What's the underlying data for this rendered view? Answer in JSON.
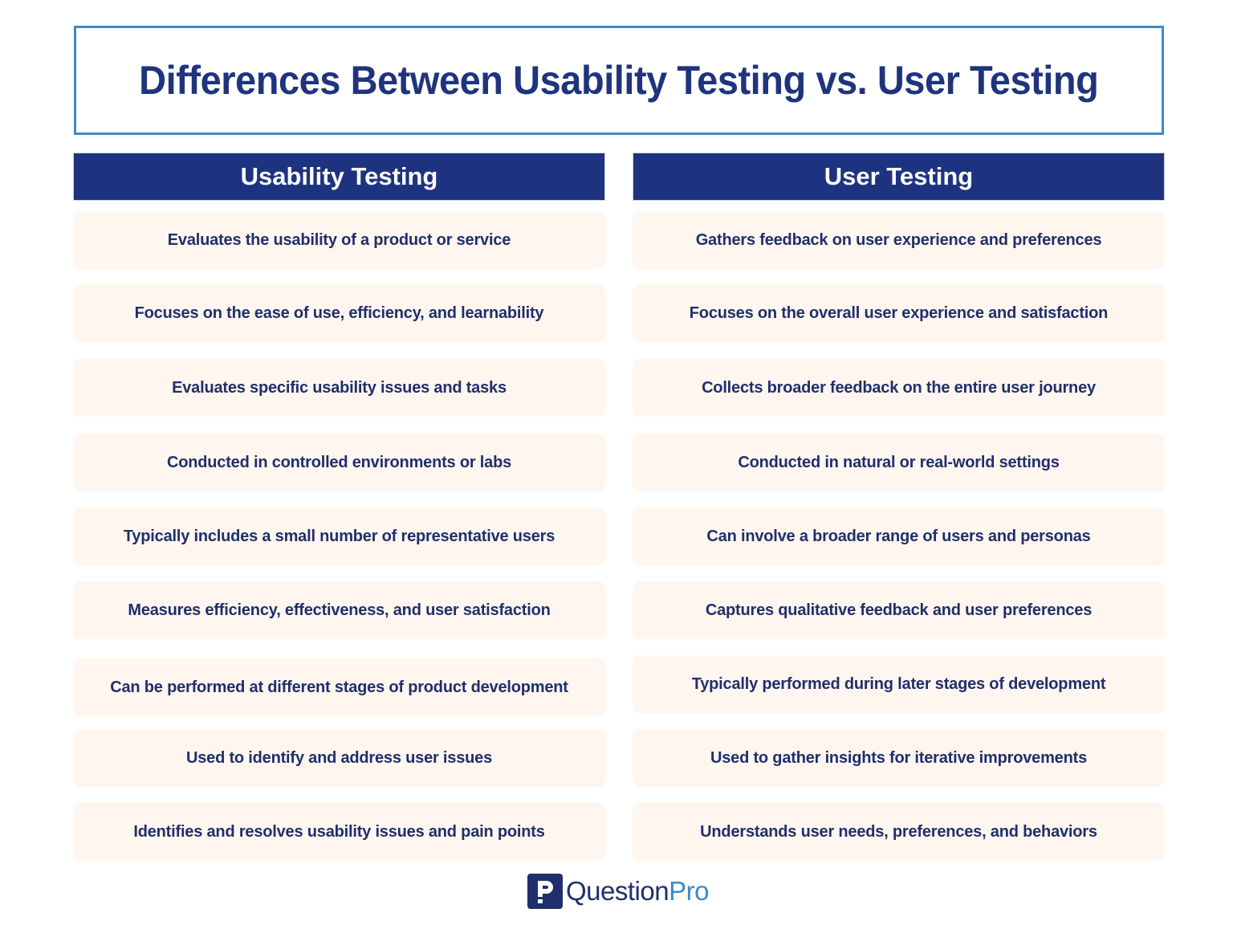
{
  "title": "Differences Between Usability Testing vs. User Testing",
  "columns": [
    {
      "header": "Usability Testing",
      "items": [
        "Evaluates the usability of a product or service",
        "Focuses on the ease of use, efficiency, and learnability",
        "Evaluates specific usability issues and tasks",
        "Conducted in controlled environments or labs",
        "Typically includes a small number of representative users",
        "Measures efficiency, effectiveness, and user satisfaction",
        "Can be performed at different stages of product development",
        "Used to identify and address user issues",
        "Identifies and resolves usability issues and pain points"
      ]
    },
    {
      "header": "User Testing",
      "items": [
        "Gathers feedback on user experience and preferences",
        "Focuses on the overall user experience and satisfaction",
        "Collects broader feedback on the entire user journey",
        "Conducted in natural or real-world settings",
        "Can involve a broader range of users and personas",
        "Captures qualitative feedback and user preferences",
        "Typically performed during later stages of development",
        "Used to gather insights for iterative improvements",
        "Understands user needs, preferences, and behaviors"
      ]
    }
  ],
  "logo": {
    "icon": "questionpro-p-icon",
    "text_primary": "Question",
    "text_accent": "Pro"
  },
  "colors": {
    "navy": "#1e3380",
    "title_border": "#3a8cc8",
    "cell_background": "#fff6f0",
    "text": "#1f2f6b"
  }
}
